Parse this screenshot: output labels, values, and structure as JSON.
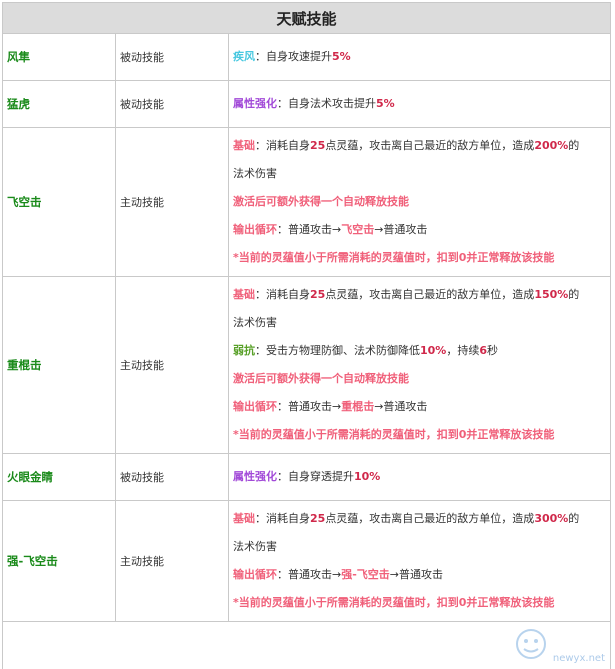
{
  "title": "天赋技能",
  "rows": [
    {
      "name": "风隼",
      "type": "被动技能",
      "lines": [
        [
          {
            "t": "疾风",
            "c": "cyan"
          },
          {
            "t": "：自身攻速提升"
          },
          {
            "t": "5%",
            "c": "num"
          }
        ]
      ]
    },
    {
      "name": "猛虎",
      "type": "被动技能",
      "lines": [
        [
          {
            "t": "属性强化",
            "c": "purple"
          },
          {
            "t": "：自身法术攻击提升"
          },
          {
            "t": "5%",
            "c": "num"
          }
        ]
      ]
    },
    {
      "name": "飞空击",
      "type": "主动技能",
      "lines": [
        [
          {
            "t": "基础",
            "c": "red"
          },
          {
            "t": "：消耗自身"
          },
          {
            "t": "25",
            "c": "num"
          },
          {
            "t": "点灵蕴，攻击离自己最近的敌方单位，造成"
          },
          {
            "t": "200%",
            "c": "num"
          },
          {
            "t": "的"
          }
        ],
        [
          {
            "t": "法术伤害"
          }
        ],
        [
          {
            "t": "激活后可额外获得一个自动释放技能",
            "c": "red"
          }
        ],
        [
          {
            "t": "输出循环",
            "c": "red"
          },
          {
            "t": "：普通攻击→"
          },
          {
            "t": "飞空击",
            "c": "red"
          },
          {
            "t": "→普通攻击"
          }
        ],
        [
          {
            "t": "*当前的灵蕴值小于所需消耗的灵蕴值时，扣到0并正常释放该技能",
            "c": "red"
          }
        ]
      ]
    },
    {
      "name": "重棍击",
      "type": "主动技能",
      "lines": [
        [
          {
            "t": "基础",
            "c": "red"
          },
          {
            "t": "：消耗自身"
          },
          {
            "t": "25",
            "c": "num"
          },
          {
            "t": "点灵蕴，攻击离自己最近的敌方单位，造成"
          },
          {
            "t": "150%",
            "c": "num"
          },
          {
            "t": "的"
          }
        ],
        [
          {
            "t": "法术伤害"
          }
        ],
        [
          {
            "t": "弱抗",
            "c": "green"
          },
          {
            "t": "：受击方物理防御、法术防御降低"
          },
          {
            "t": "10%",
            "c": "num"
          },
          {
            "t": "，持续"
          },
          {
            "t": "6",
            "c": "num"
          },
          {
            "t": "秒"
          }
        ],
        [
          {
            "t": "激活后可额外获得一个自动释放技能",
            "c": "red"
          }
        ],
        [
          {
            "t": "输出循环",
            "c": "red"
          },
          {
            "t": "：普通攻击→"
          },
          {
            "t": "重棍击",
            "c": "red"
          },
          {
            "t": "→普通攻击"
          }
        ],
        [
          {
            "t": "*当前的灵蕴值小于所需消耗的灵蕴值时，扣到0并正常释放该技能",
            "c": "red"
          }
        ]
      ]
    },
    {
      "name": "火眼金睛",
      "type": "被动技能",
      "lines": [
        [
          {
            "t": "属性强化",
            "c": "purple"
          },
          {
            "t": "：自身穿透提升"
          },
          {
            "t": "10%",
            "c": "num"
          }
        ]
      ]
    },
    {
      "name": "强-飞空击",
      "type": "主动技能",
      "lines": [
        [
          {
            "t": "基础",
            "c": "red"
          },
          {
            "t": "：消耗自身"
          },
          {
            "t": "25",
            "c": "num"
          },
          {
            "t": "点灵蕴，攻击离自己最近的敌方单位，造成"
          },
          {
            "t": "300%",
            "c": "num"
          },
          {
            "t": "的"
          }
        ],
        [
          {
            "t": "法术伤害"
          }
        ],
        [
          {
            "t": "输出循环",
            "c": "red"
          },
          {
            "t": "：普通攻击→"
          },
          {
            "t": "强-飞空击",
            "c": "red"
          },
          {
            "t": "→普通攻击"
          }
        ],
        [
          {
            "t": "*当前的灵蕴值小于所需消耗的灵蕴值时，扣到0并正常释放该技能",
            "c": "red"
          }
        ]
      ]
    }
  ],
  "watermark": {
    "text": "newyx.net"
  },
  "colors": {
    "name_green": "#1a8a1a",
    "highlight_red": "#f0607a",
    "number_red": "#d0284a",
    "purple": "#a24ad8",
    "cyan": "#48c8e0",
    "green": "#58a028"
  }
}
